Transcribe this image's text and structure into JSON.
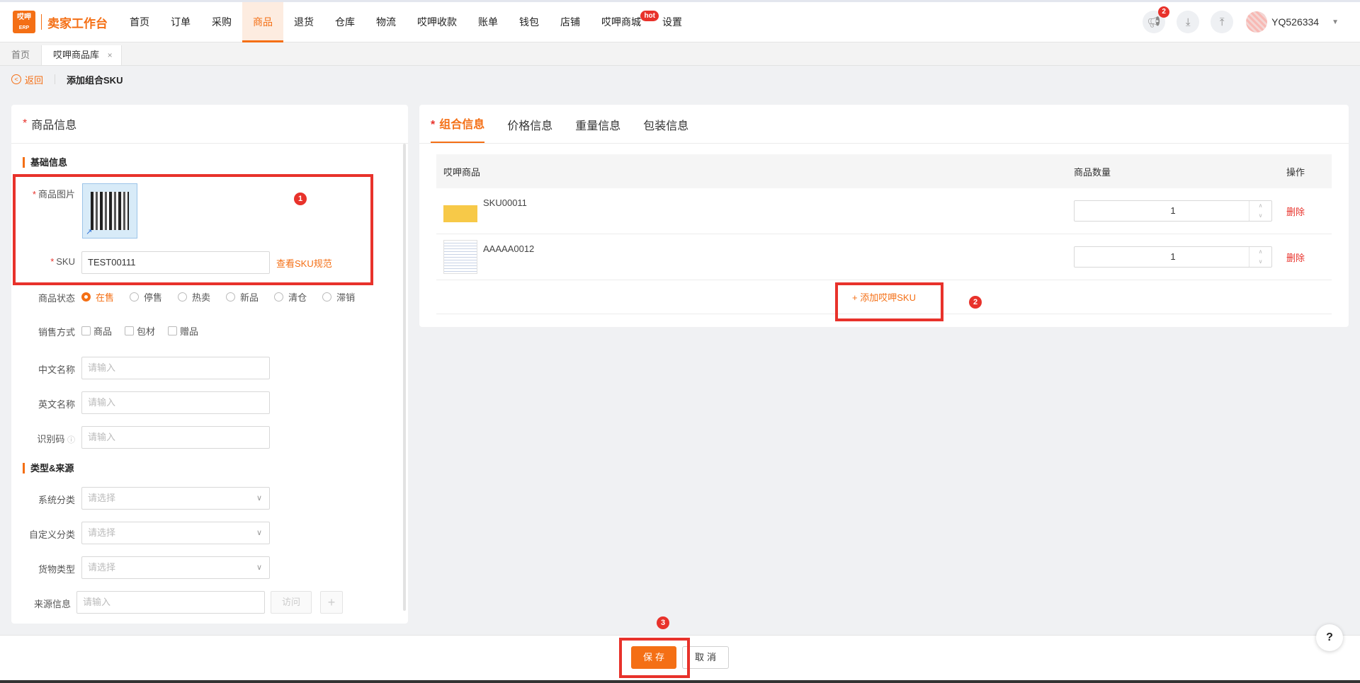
{
  "colors": {
    "accent": "#f46f15",
    "danger": "#e8322b"
  },
  "brand": {
    "logo_top": "哎呷",
    "logo_bottom": "ERP",
    "title": "卖家工作台"
  },
  "nav": {
    "items": [
      "首页",
      "订单",
      "采购",
      "商品",
      "退货",
      "仓库",
      "物流",
      "哎呷收款",
      "账单",
      "钱包",
      "店铺",
      "哎呷商城",
      "设置"
    ],
    "active": "商品",
    "hot_label": "hot"
  },
  "header": {
    "notification_count": "2",
    "username": "YQ526334",
    "icons": [
      "megaphone-icon",
      "download-icon",
      "upload-icon"
    ]
  },
  "page_tabs": {
    "home": "首页",
    "current": "哎呷商品库",
    "close": "×"
  },
  "breadcrumb": {
    "back": "返回",
    "title": "添加组合SKU"
  },
  "left_panel": {
    "title": "商品信息",
    "basic_section": "基础信息",
    "image_label": "商品图片",
    "sku_label": "SKU",
    "sku_value": "TEST00111",
    "sku_rule_link": "查看SKU规范",
    "status_label": "商品状态",
    "status_options": [
      "在售",
      "停售",
      "热卖",
      "新品",
      "清仓",
      "滞销"
    ],
    "status_selected": "在售",
    "sale_label": "销售方式",
    "sale_options": [
      "商品",
      "包材",
      "赠品"
    ],
    "cn_name_label": "中文名称",
    "en_name_label": "英文名称",
    "code_label": "识别码",
    "input_placeholder": "请输入",
    "type_section": "类型&来源",
    "sys_category_label": "系统分类",
    "custom_category_label": "自定义分类",
    "goods_type_label": "货物类型",
    "select_placeholder": "请选择",
    "source_label": "来源信息",
    "visit_button": "访问",
    "add_button": "+"
  },
  "right_panel": {
    "tabs": [
      "组合信息",
      "价格信息",
      "重量信息",
      "包装信息"
    ],
    "active_tab": "组合信息",
    "columns": [
      "哎呷商品",
      "商品数量",
      "操作"
    ],
    "rows": [
      {
        "sku": "SKU00011",
        "qty": "1",
        "action": "删除"
      },
      {
        "sku": "AAAAA0012",
        "qty": "1",
        "action": "删除"
      }
    ],
    "add_sku": "+ 添加哎呷SKU"
  },
  "footer": {
    "save": "保存",
    "cancel": "取消"
  },
  "help": "?",
  "annotations": [
    "1",
    "2",
    "3"
  ]
}
